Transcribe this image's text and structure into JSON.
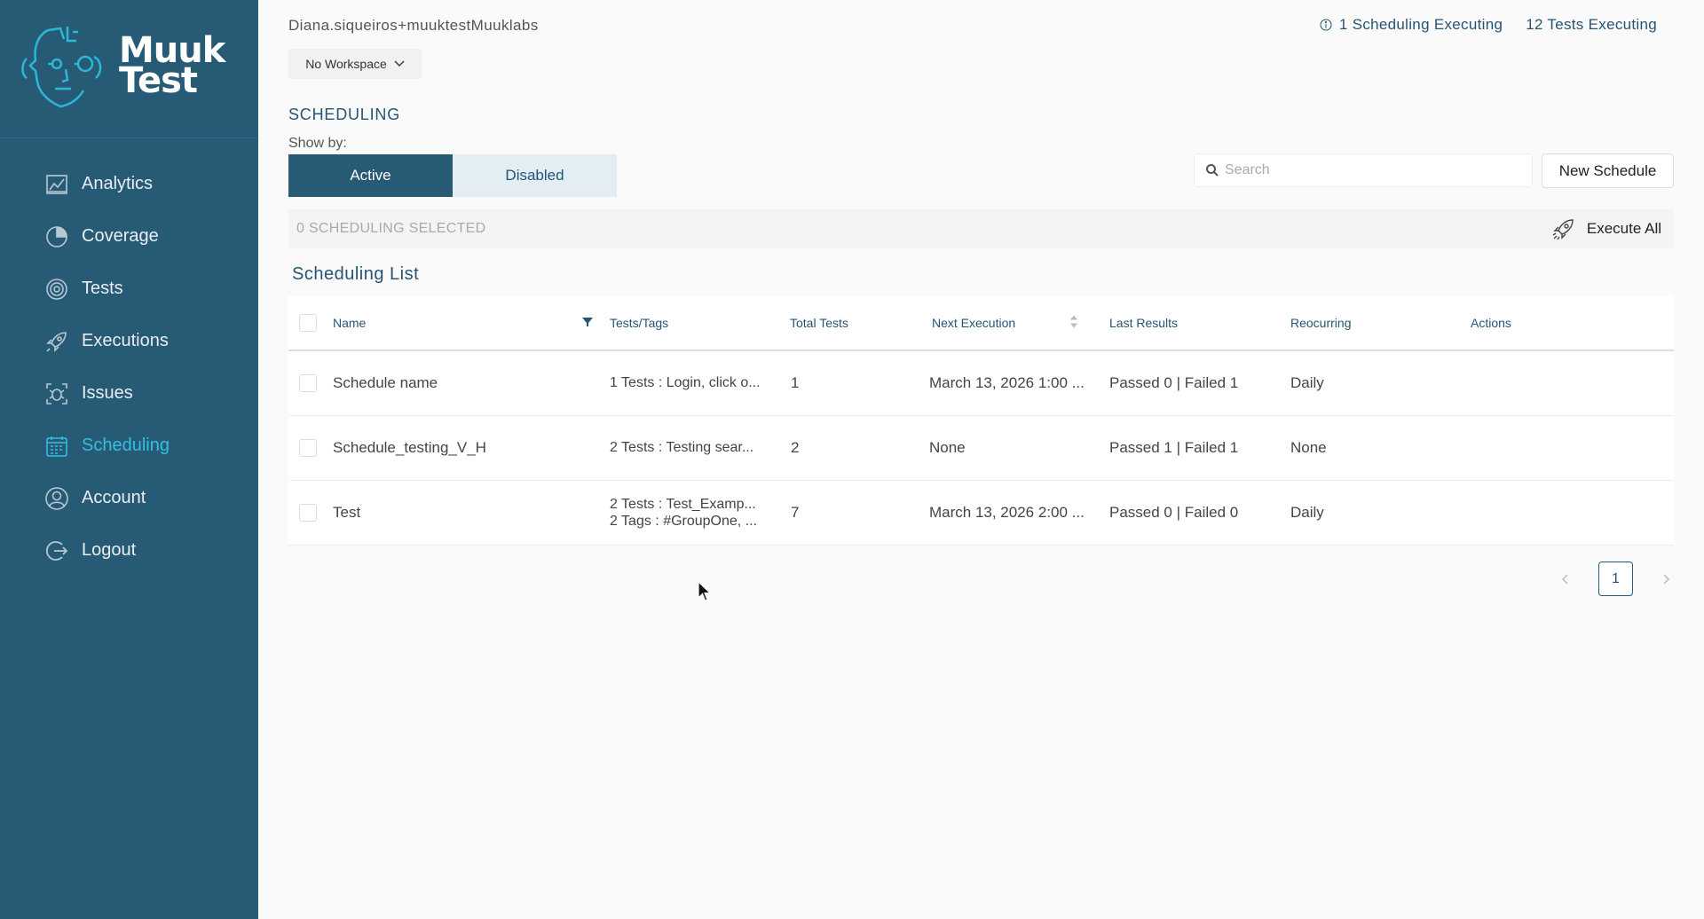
{
  "app": {
    "brand_line1": "Muuk",
    "brand_line2": "Test"
  },
  "sidebar": {
    "items": [
      {
        "label": "Analytics",
        "icon": "analytics-icon"
      },
      {
        "label": "Coverage",
        "icon": "coverage-icon"
      },
      {
        "label": "Tests",
        "icon": "tests-icon"
      },
      {
        "label": "Executions",
        "icon": "rocket-icon"
      },
      {
        "label": "Issues",
        "icon": "bug-icon"
      },
      {
        "label": "Scheduling",
        "icon": "calendar-icon",
        "active": true
      },
      {
        "label": "Account",
        "icon": "user-icon"
      },
      {
        "label": "Logout",
        "icon": "logout-icon"
      }
    ],
    "accent_color": "#34bfe3",
    "background": "#275a75"
  },
  "header": {
    "user_email": "Diana.siqueiros+muuktestMuuklabs",
    "scheduling_executing": "1 Scheduling Executing",
    "tests_executing": "12 Tests Executing",
    "workspace": "No Workspace"
  },
  "page": {
    "title": "SCHEDULING",
    "show_by_label": "Show by:",
    "toggle_active": "Active",
    "toggle_disabled": "Disabled",
    "search_placeholder": "Search",
    "new_schedule": "New Schedule",
    "selected_count": "0 SCHEDULING SELECTED",
    "execute_all": "Execute All",
    "list_title": "Scheduling List"
  },
  "table": {
    "headers": {
      "name": "Name",
      "tags": "Tests/Tags",
      "total": "Total Tests",
      "next": "Next Execution",
      "last": "Last Results",
      "recurring": "Reocurring",
      "actions": "Actions"
    },
    "rows": [
      {
        "name": "Schedule name",
        "tags_line1": "1 Tests : Login, click o...",
        "tags_line2": "",
        "total": "1",
        "next": "March 13, 2026 1:00 ...",
        "last": "Passed 0 | Failed 1",
        "recurring": "Daily"
      },
      {
        "name": "Schedule_testing_V_H",
        "tags_line1": "2 Tests : Testing sear...",
        "tags_line2": "",
        "total": "2",
        "next": "None",
        "last": "Passed 1 | Failed 1",
        "recurring": "None"
      },
      {
        "name": "Test",
        "tags_line1": "2 Tests : Test_Examp...",
        "tags_line2": "2 Tags : #GroupOne, ...",
        "total": "7",
        "next": "March 13, 2026 2:00 ...",
        "last": "Passed 0 | Failed 0",
        "recurring": "Daily"
      }
    ]
  },
  "pagination": {
    "current_page": "1"
  }
}
